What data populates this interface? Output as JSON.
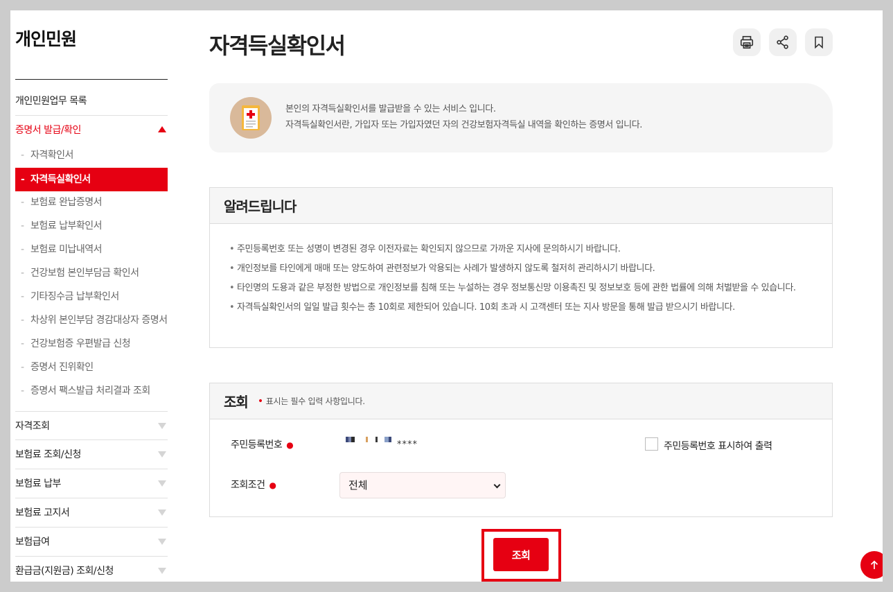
{
  "sidebar": {
    "title": "개인민원",
    "items_top": [
      {
        "label": "개인민원업무 목록"
      },
      {
        "label": "증명서 발급/확인"
      }
    ],
    "sub_items": [
      {
        "label": "자격확인서"
      },
      {
        "label": "자격득실확인서"
      },
      {
        "label": "보험료 완납증명서"
      },
      {
        "label": "보험료 납부확인서"
      },
      {
        "label": "보험료 미납내역서"
      },
      {
        "label": "건강보험 본인부담금 확인서"
      },
      {
        "label": "기타징수금 납부확인서"
      },
      {
        "label": "차상위 본인부담 경감대상자 증명서"
      },
      {
        "label": "건강보험증 우편발급 신청"
      },
      {
        "label": "증명서 진위확인"
      },
      {
        "label": "증명서 팩스발급 처리결과 조회"
      }
    ],
    "items_bottom": [
      {
        "label": "자격조회"
      },
      {
        "label": "보험료 조회/신청"
      },
      {
        "label": "보험료 납부"
      },
      {
        "label": "보험료 고지서"
      },
      {
        "label": "보험급여"
      },
      {
        "label": "환급금(지원금) 조회/신청"
      }
    ]
  },
  "header": {
    "title": "자격득실확인서",
    "tools": [
      "printer-icon",
      "share-icon",
      "bookmark-icon"
    ]
  },
  "intro": {
    "line1": "본인의 자격득실확인서를 발급받을 수 있는 서비스 입니다.",
    "line2": "자격득실확인서란, 가입자 또는 가입자였던 자의 건강보험자격득실 내역을 확인하는 증명서 입니다."
  },
  "notice": {
    "title": "알려드립니다",
    "items": [
      "주민등록번호 또는 성명이 변경된 경우 이전자료는 확인되지 않으므로 가까운 지사에 문의하시기 바랍니다.",
      "개인정보를 타인에게 매매 또는 양도하여 관련정보가 악용되는 사례가 발생하지 않도록 철저히 관리하시기 바랍니다.",
      "타인명의 도용과 같은 부정한 방법으로 개인정보를 침해 또는 누설하는 경우 정보통신망 이용촉진 및 정보보호 등에 관한 법률에 의해 처벌받을 수 있습니다.",
      "자격득실확인서의 일일 발급 횟수는 총 10회로 제한되어 있습니다. 10회 초과 시 고객센터 또는 지사 방문을 통해 발급 받으시기 바랍니다."
    ]
  },
  "form": {
    "title": "조회",
    "required_note": "표시는 필수 입력 사항입니다.",
    "rrn_label": "주민등록번호",
    "rrn_masked_suffix": "****",
    "print_rrn_label": "주민등록번호 표시하여 출력",
    "condition_label": "조회조건",
    "condition_value": "전체",
    "submit_label": "조회"
  },
  "colors": {
    "accent": "#e60012",
    "page_bg": "#cccccc"
  }
}
